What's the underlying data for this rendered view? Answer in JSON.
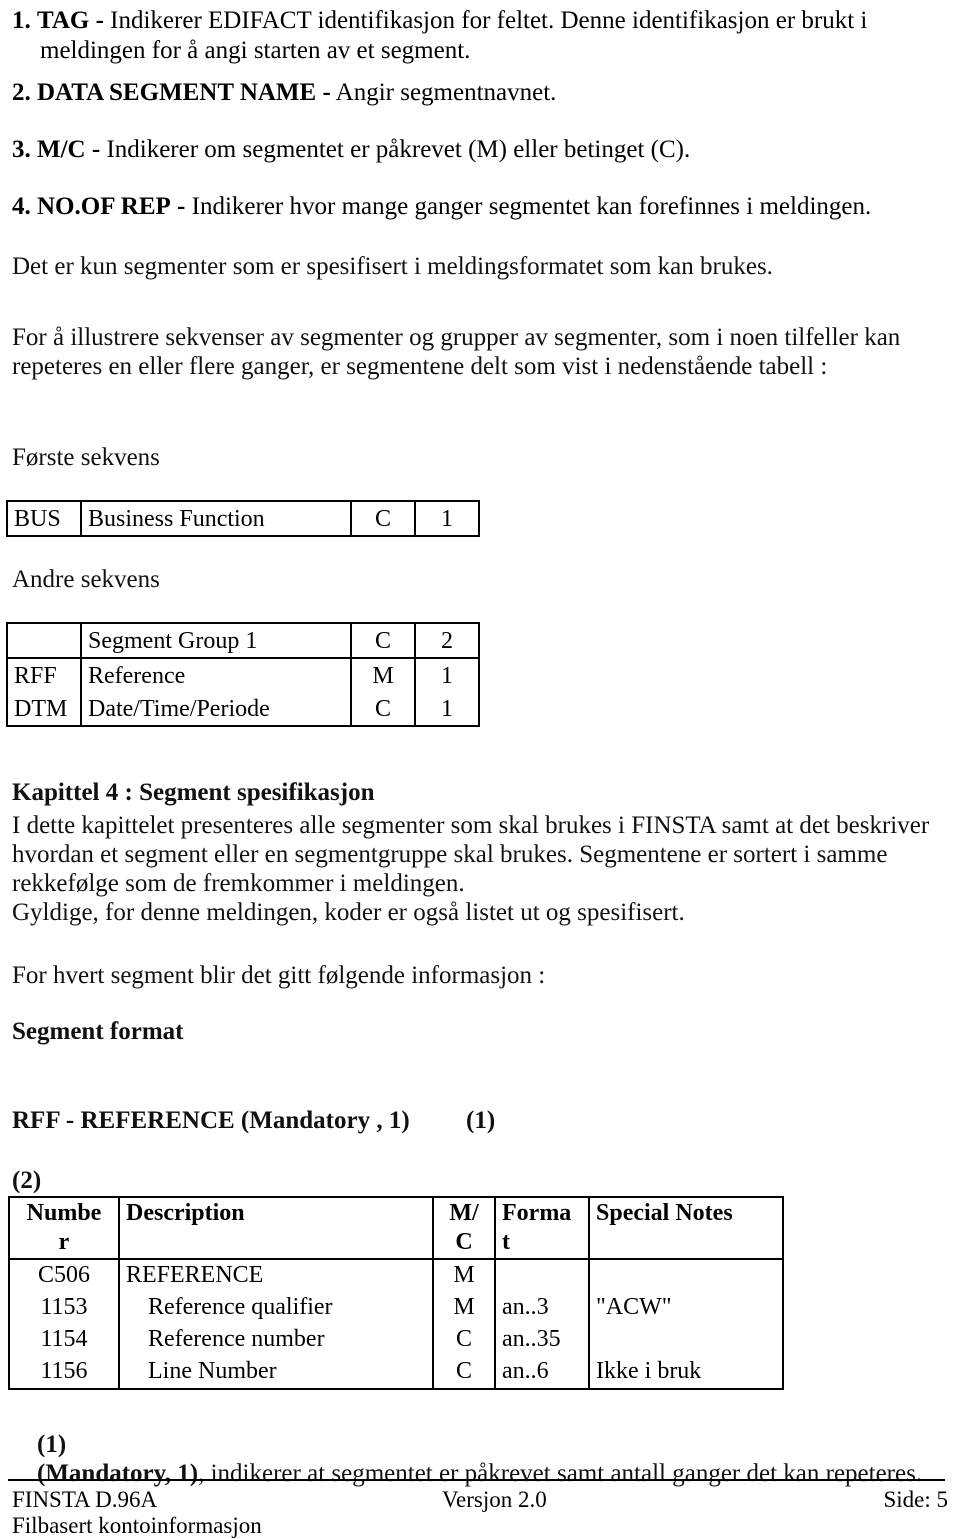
{
  "document": {
    "title": "FINSTA D.96A - Filbasert kontoinformasjon - Side 5"
  },
  "definitions": [
    {
      "number": "1.",
      "term": "TAG",
      "dash": "-",
      "text": "Indikerer EDIFACT identifikasjon for feltet. Denne identifikasjon er brukt i",
      "continuation": "meldingen for å angi starten av et segment."
    },
    {
      "number": "2.",
      "term": "DATA SEGMENT NAME",
      "dash": "-",
      "text": "Angir segmentnavnet.",
      "continuation": ""
    },
    {
      "number": "3.",
      "term": "M/C",
      "dash": "-",
      "text": "Indikerer om segmentet er påkrevet (M) eller betinget (C).",
      "continuation": ""
    },
    {
      "number": "4.",
      "term": "NO.OF REP",
      "dash": "-",
      "text": "Indikerer hvor mange ganger segmentet kan forefinnes i meldingen.",
      "continuation": ""
    }
  ],
  "paragraphs": {
    "only_specified": "Det er kun segmenter som er spesifisert i meldingsformatet som kan brukes.",
    "illustrate_line1": "For å illustrere sekvenser av segmenter og grupper av segmenter, som i noen tilfeller kan",
    "illustrate_line2": "repeteres en eller flere ganger, er segmentene delt som vist i nedenstående tabell :",
    "first_sequence_label": "Første sekvens",
    "second_sequence_label": "Andre sekvens",
    "chapter_heading": "Kapittel 4 : Segment spesifikasjon",
    "chapter_line1": "I dette kapittelet presenteres alle segmenter som skal brukes i FINSTA samt at det beskriver",
    "chapter_line2": "hvordan et segment eller en segmentgruppe skal brukes. Segmentene er sortert i samme",
    "chapter_line3": "rekkefølge som de fremkommer i meldingen.",
    "chapter_line4": "Gyldige, for denne meldingen, koder er også listet ut og spesifisert.",
    "for_each_segment": "For hvert segment blir det gitt følgende informasjon :",
    "segment_format_heading": "Segment format"
  },
  "first_sequence_table": {
    "rows": [
      {
        "tag": "BUS",
        "description": "Business Function",
        "mc": "C",
        "rep": "1"
      }
    ]
  },
  "second_sequence_table": {
    "rows": [
      {
        "tag": "",
        "description": "Segment Group 1",
        "mc": "C",
        "rep": "2"
      },
      {
        "tag": "RFF",
        "description": "Reference",
        "mc": "M",
        "rep": "1"
      },
      {
        "tag": "DTM",
        "description": "Date/Time/Periode",
        "mc": "C",
        "rep": "1"
      }
    ]
  },
  "segment_spec": {
    "heading": "RFF - REFERENCE (Mandatory , 1)",
    "heading_marker": "(1)",
    "table_marker": "(2)",
    "columns": [
      {
        "label": "Numbe r"
      },
      {
        "label": "Description"
      },
      {
        "label": "M/ C"
      },
      {
        "label": "Forma t"
      },
      {
        "label": "Special Notes"
      }
    ],
    "column_labels": {
      "number_line1": "Numbe",
      "number_line2": "r",
      "description": "Description",
      "mc_line1": "M/",
      "mc_line2": "C",
      "format_line1": "Forma",
      "format_line2": "t",
      "special_notes": "Special Notes"
    },
    "rows": [
      {
        "number": "C506",
        "description": "REFERENCE",
        "indent": false,
        "mc": "M",
        "format": "",
        "notes": ""
      },
      {
        "number": "1153",
        "description": "Reference qualifier",
        "indent": true,
        "mc": "M",
        "format": "an..3",
        "notes": "\"ACW\""
      },
      {
        "number": "1154",
        "description": "Reference number",
        "indent": true,
        "mc": "C",
        "format": "an..35",
        "notes": ""
      },
      {
        "number": "1156",
        "description": "Line Number",
        "indent": true,
        "mc": "C",
        "format": "an..6",
        "notes": "Ikke i bruk"
      }
    ]
  },
  "footnote": {
    "marker": "(1)",
    "bold_part": "(Mandatory, 1)",
    "rest": ", indikerer at segmentet er påkrevet samt antall ganger det kan repeteres."
  },
  "footer": {
    "left_line1": "FINSTA D.96A",
    "left_line2": "Filbasert kontoinformasjon",
    "center": "Versjon 2.0",
    "right": "Side: 5"
  }
}
